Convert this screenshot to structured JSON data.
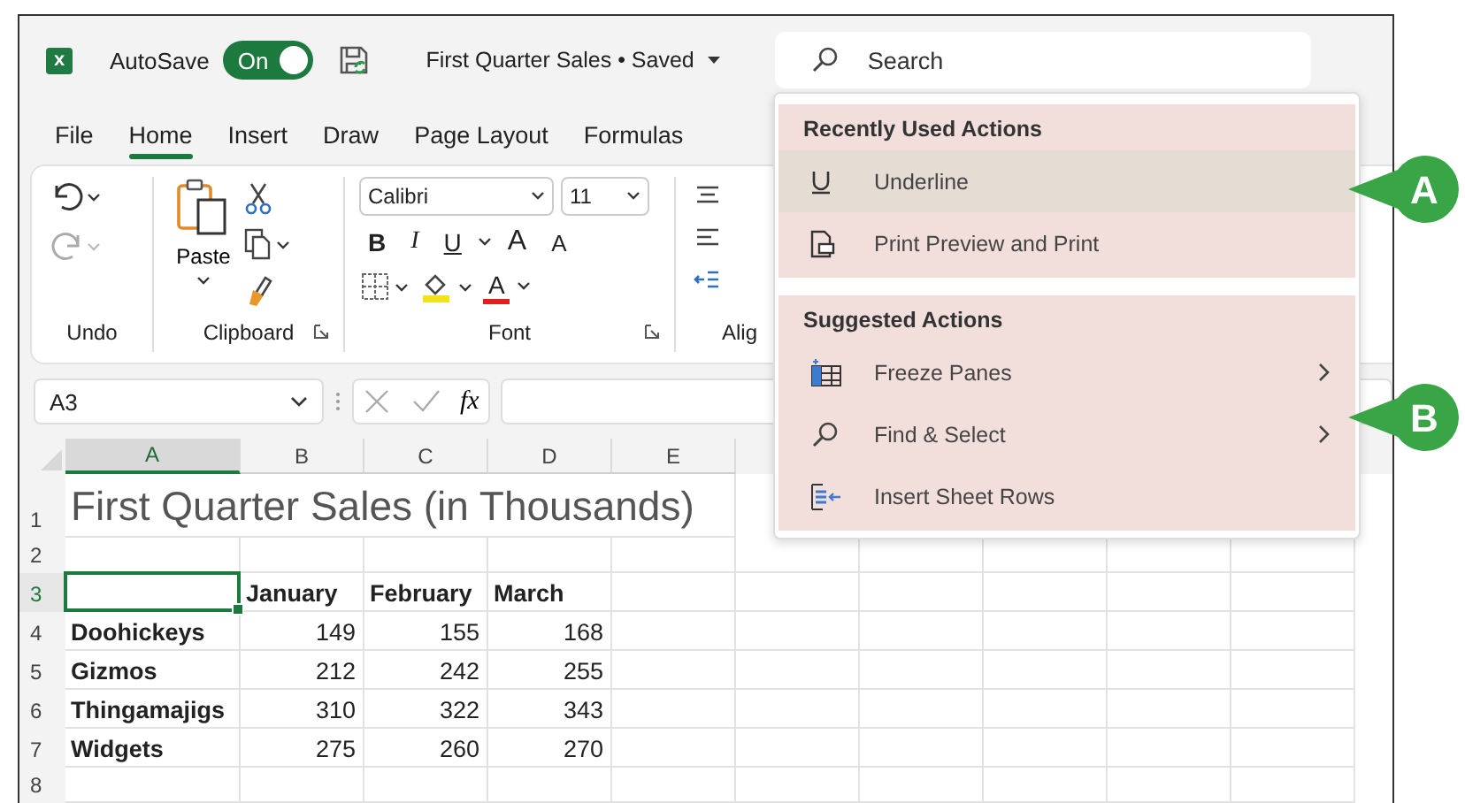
{
  "title_bar": {
    "app_letter": "x",
    "autosave_label": "AutoSave",
    "autosave_state": "On",
    "autosave_on": true,
    "document_title": "First Quarter Sales • Saved"
  },
  "search": {
    "placeholder": "Search"
  },
  "tabs": [
    {
      "label": "File",
      "selected": false
    },
    {
      "label": "Home",
      "selected": true
    },
    {
      "label": "Insert",
      "selected": false
    },
    {
      "label": "Draw",
      "selected": false
    },
    {
      "label": "Page Layout",
      "selected": false
    },
    {
      "label": "Formulas",
      "selected": false
    }
  ],
  "ribbon": {
    "groups": [
      {
        "label": "Undo",
        "launcher": false
      },
      {
        "label": "Clipboard",
        "launcher": true
      },
      {
        "label": "Font",
        "launcher": true
      },
      {
        "label": "Alig",
        "launcher": false
      }
    ],
    "paste_label": "Paste",
    "font_name": "Calibri",
    "font_size": "11",
    "bold": "B",
    "italic": "I",
    "underline": "U",
    "grow": "A",
    "shrink": "A",
    "font_color": "A"
  },
  "formula_bar": {
    "name_box": "A3",
    "fx": "fx"
  },
  "sheet": {
    "columns": [
      {
        "label": "A",
        "selected": true
      },
      {
        "label": "B",
        "selected": false
      },
      {
        "label": "C",
        "selected": false
      },
      {
        "label": "D",
        "selected": false
      },
      {
        "label": "E",
        "selected": false
      }
    ],
    "rows": [
      {
        "number": "1",
        "kind": "title",
        "selected": false,
        "cells": [
          "First Quarter Sales (in Thousands)"
        ]
      },
      {
        "number": "2",
        "kind": "blank",
        "selected": false,
        "cells": []
      },
      {
        "number": "3",
        "kind": "header",
        "selected": true,
        "cells": [
          "",
          "January",
          "February",
          "March"
        ]
      },
      {
        "number": "4",
        "kind": "data",
        "selected": false,
        "cells": [
          "Doohickeys",
          "149",
          "155",
          "168"
        ]
      },
      {
        "number": "5",
        "kind": "data",
        "selected": false,
        "cells": [
          "Gizmos",
          "212",
          "242",
          "255"
        ]
      },
      {
        "number": "6",
        "kind": "data",
        "selected": false,
        "cells": [
          "Thingamajigs",
          "310",
          "322",
          "343"
        ]
      },
      {
        "number": "7",
        "kind": "data",
        "selected": false,
        "cells": [
          "Widgets",
          "275",
          "260",
          "270"
        ]
      },
      {
        "number": "8",
        "kind": "blank",
        "selected": false,
        "cells": []
      }
    ]
  },
  "menu": {
    "sections": [
      {
        "heading": "Recently Used Actions",
        "items": [
          {
            "label": "Underline",
            "kind": "underline",
            "selected": true,
            "submenu": false
          },
          {
            "label": "Print Preview and Print",
            "kind": "print",
            "selected": false,
            "submenu": false
          }
        ]
      },
      {
        "heading": "Suggested Actions",
        "items": [
          {
            "label": "Freeze Panes",
            "kind": "freeze",
            "selected": false,
            "submenu": true
          },
          {
            "label": "Find & Select",
            "kind": "find",
            "selected": false,
            "submenu": true
          },
          {
            "label": "Insert Sheet Rows",
            "kind": "insert-rows",
            "selected": false,
            "submenu": false
          }
        ]
      }
    ]
  },
  "callouts": [
    {
      "letter": "A"
    },
    {
      "letter": "B"
    }
  ]
}
